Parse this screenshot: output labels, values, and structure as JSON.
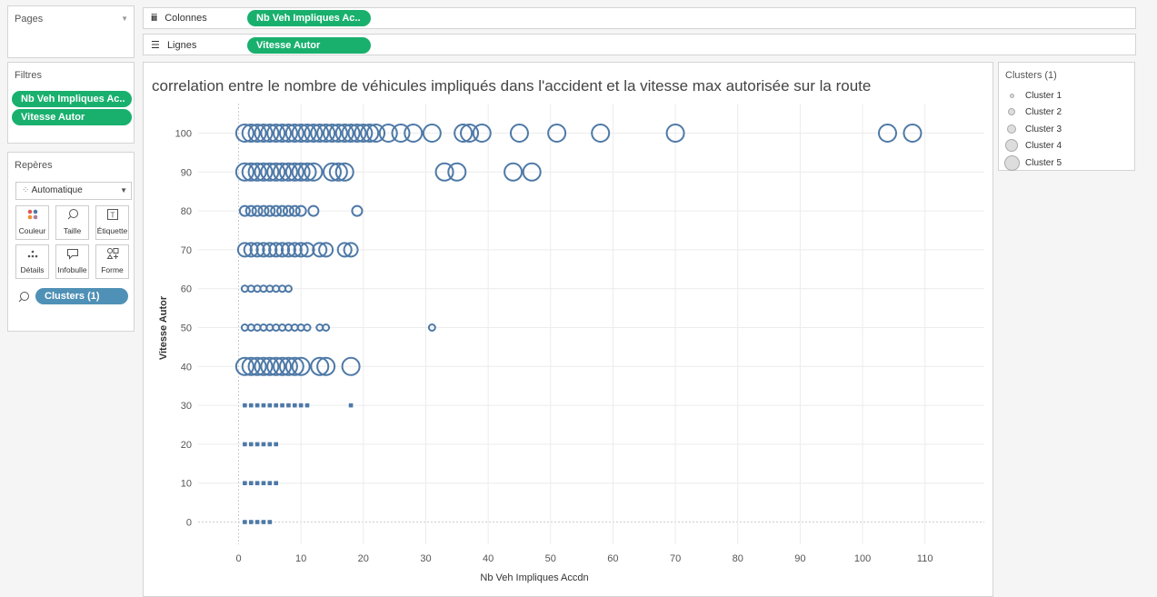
{
  "pages_card": {
    "title": "Pages"
  },
  "shelves": {
    "columns": {
      "label": "Colonnes",
      "icon": "iii",
      "pill": "Nb Veh Impliques Ac.."
    },
    "rows": {
      "label": "Lignes",
      "icon": "☰",
      "pill": "Vitesse Autor"
    }
  },
  "filters": {
    "title": "Filtres",
    "items": [
      "Nb Veh Impliques Ac..",
      "Vitesse Autor"
    ]
  },
  "marks": {
    "title": "Repères",
    "type": "Automatique",
    "buttons": [
      {
        "label": "Couleur",
        "icon": "color-dots-icon"
      },
      {
        "label": "Taille",
        "icon": "size-icon"
      },
      {
        "label": "Étiquette",
        "icon": "label-icon"
      },
      {
        "label": "Détails",
        "icon": "detail-icon"
      },
      {
        "label": "Infobulle",
        "icon": "tooltip-icon"
      },
      {
        "label": "Forme",
        "icon": "shape-icon"
      }
    ],
    "size_pill": "Clusters (1)"
  },
  "legend": {
    "title": "Clusters (1)",
    "items": [
      "Cluster 1",
      "Cluster 2",
      "Cluster 3",
      "Cluster 4",
      "Cluster 5"
    ]
  },
  "colors": {
    "pill_green": "#19b06e",
    "pill_blue": "#4f90b6",
    "mark": "#4e79a7"
  },
  "chart_data": {
    "type": "scatter",
    "title": "correlation entre le nombre de véhicules impliqués dans l'accident et la vitesse max autorisée sur la route",
    "xlabel": "Nb Veh Impliques Accdn",
    "ylabel": "Vitesse Autor",
    "xlim": [
      -5,
      115
    ],
    "ylim": [
      0,
      100
    ],
    "xticks": [
      0,
      10,
      20,
      30,
      40,
      50,
      60,
      70,
      80,
      90,
      100,
      110
    ],
    "yticks": [
      0,
      10,
      20,
      30,
      40,
      50,
      60,
      70,
      80,
      90,
      100
    ],
    "shape_note": "size encodes cluster (1 smallest .. 5 largest)",
    "series": [
      {
        "y": 100,
        "cluster": 5,
        "x": [
          1,
          2,
          3,
          4,
          5,
          6,
          7,
          8,
          9,
          10,
          11,
          12,
          13,
          14,
          15,
          16,
          17,
          18,
          19,
          20,
          21,
          22,
          24,
          26,
          28,
          31,
          36,
          37,
          39,
          45,
          51,
          58,
          70,
          104,
          108
        ]
      },
      {
        "y": 90,
        "cluster": 5,
        "x": [
          1,
          2,
          3,
          4,
          5,
          6,
          7,
          8,
          9,
          10,
          11,
          12,
          15,
          16,
          17,
          33,
          35,
          44,
          47
        ]
      },
      {
        "y": 80,
        "cluster": 3,
        "x": [
          1,
          2,
          3,
          4,
          5,
          6,
          7,
          8,
          9,
          10,
          12,
          19
        ]
      },
      {
        "y": 70,
        "cluster": 4,
        "x": [
          1,
          2,
          3,
          4,
          5,
          6,
          7,
          8,
          9,
          10,
          11,
          13,
          14,
          17,
          18
        ]
      },
      {
        "y": 60,
        "cluster": 2,
        "x": [
          1,
          2,
          3,
          4,
          5,
          6,
          7,
          8
        ]
      },
      {
        "y": 50,
        "cluster": 2,
        "x": [
          1,
          2,
          3,
          4,
          5,
          6,
          7,
          8,
          9,
          10,
          11,
          13,
          14,
          31
        ]
      },
      {
        "y": 40,
        "cluster": 5,
        "x": [
          1,
          2,
          3,
          4,
          5,
          6,
          7,
          8,
          9,
          10,
          13,
          14,
          18
        ]
      },
      {
        "y": 30,
        "cluster": 1,
        "x": [
          1,
          2,
          3,
          4,
          5,
          6,
          7,
          8,
          9,
          10,
          11,
          18
        ]
      },
      {
        "y": 20,
        "cluster": 1,
        "x": [
          1,
          2,
          3,
          4,
          5,
          6
        ]
      },
      {
        "y": 10,
        "cluster": 1,
        "x": [
          1,
          2,
          3,
          4,
          5,
          6
        ]
      },
      {
        "y": 0,
        "cluster": 1,
        "x": [
          1,
          2,
          3,
          4,
          5
        ]
      }
    ]
  }
}
